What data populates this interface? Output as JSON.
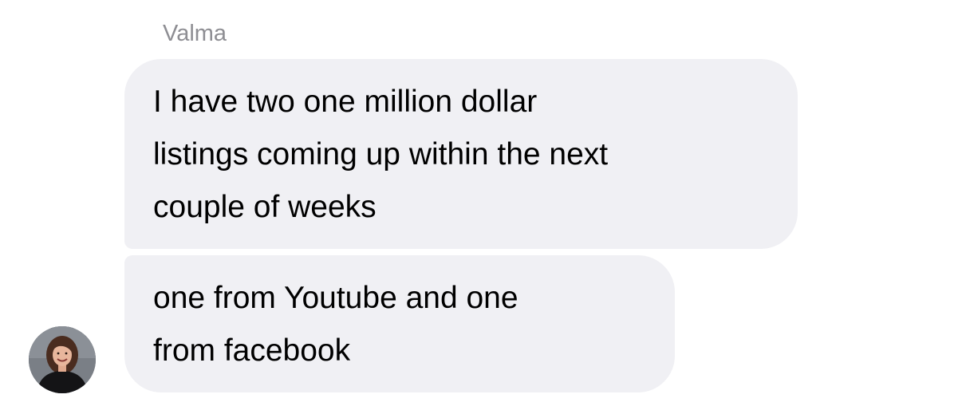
{
  "conversation": {
    "sender_name": "Valma",
    "avatar_icon": "contact-photo-avatar",
    "bubble_color": "#f0f0f4",
    "messages": [
      {
        "lines": [
          "I have two one million dollar",
          "listings coming up within the next",
          "couple of weeks"
        ]
      },
      {
        "lines": [
          "one from Youtube and one",
          "from facebook"
        ]
      }
    ]
  }
}
